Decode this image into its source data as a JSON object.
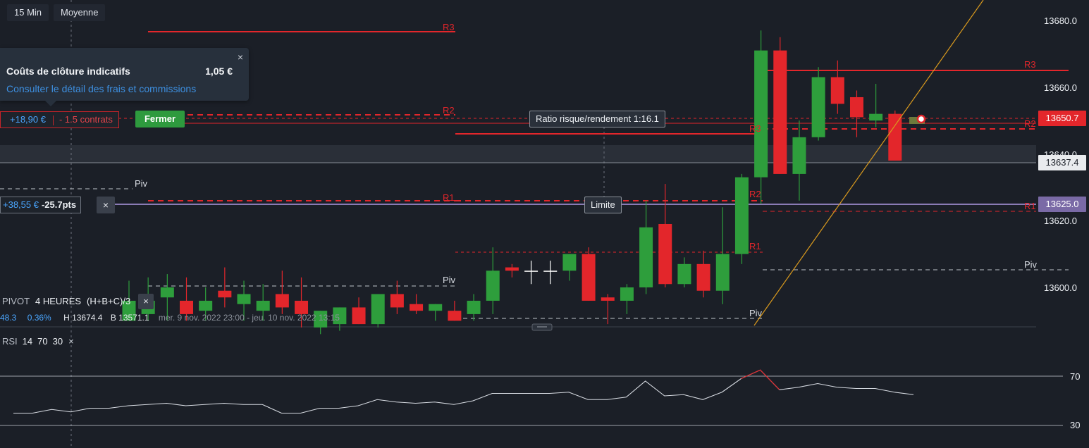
{
  "toolbar": {
    "timeframe": "15 Min",
    "chart_style": "Moyenne"
  },
  "popup": {
    "title": "Coûts de clôture indicatifs",
    "amount": "1,05 €",
    "link": "Consulter le détail des frais et commissions",
    "close": "×"
  },
  "position_main": {
    "pnl": "+18,90 €",
    "quantity": "- 1.5 contrats",
    "close_label": "Fermer"
  },
  "ratio_label": "Ratio risque/rendement 1:16.1",
  "position_limit": {
    "pnl": "+38,55 €",
    "points": "-25.7pts",
    "close": "×"
  },
  "limit_label": "Limite",
  "pivot_indicator": {
    "name": "PIVOT",
    "period": "4 HEURES",
    "formula": "(H+B+C)/3",
    "close": "×",
    "value_a": "48.3",
    "change": "0.36%",
    "high": "H 13674.4",
    "low": "B 13571.1",
    "range": "mer. 9 nov. 2022 23:00 - jeu. 10 nov. 2022 13:15"
  },
  "rsi_indicator": {
    "name": "RSI",
    "p1": "14",
    "p2": "70",
    "p3": "30",
    "close": "×"
  },
  "price_axis": [
    "13680.0",
    "13660.0",
    "13640.0",
    "13620.0",
    "13600.0"
  ],
  "price_tags": {
    "current": "13650.7",
    "line": "13637.4",
    "limit": "13625.0"
  },
  "rsi_axis": [
    "70",
    "30"
  ],
  "pivot_labels": {
    "r3": "R3",
    "r2": "R2",
    "r1": "R1",
    "piv": "Piv"
  },
  "colors": {
    "background": "#1b1f27",
    "bull": "#2e9e3c",
    "bear": "#e3262b",
    "pivot_resistance": "#e3262b",
    "trendline": "#d99a1e",
    "limit_line": "#8a7bb5",
    "link": "#3d8fe0"
  },
  "chart_data": {
    "type": "candlestick",
    "price_range": [
      13588,
      13684
    ],
    "y_ticks": [
      13680,
      13660,
      13640,
      13620,
      13600
    ],
    "candles": [
      {
        "o": 13590,
        "h": 13602,
        "l": 13590,
        "c": 13596
      },
      {
        "o": 13592,
        "h": 13603,
        "l": 13590,
        "c": 13596
      },
      {
        "o": 13597,
        "h": 13604,
        "l": 13590,
        "c": 13600
      },
      {
        "o": 13596,
        "h": 13603,
        "l": 13590,
        "c": 13592
      },
      {
        "o": 13593,
        "h": 13600,
        "l": 13590,
        "c": 13596
      },
      {
        "o": 13599,
        "h": 13606,
        "l": 13594,
        "c": 13597
      },
      {
        "o": 13595,
        "h": 13602,
        "l": 13590,
        "c": 13598
      },
      {
        "o": 13593,
        "h": 13601,
        "l": 13590,
        "c": 13596
      },
      {
        "o": 13598,
        "h": 13605,
        "l": 13592,
        "c": 13594
      },
      {
        "o": 13596,
        "h": 13603,
        "l": 13588,
        "c": 13592
      },
      {
        "o": 13588,
        "h": 13593,
        "l": 13586,
        "c": 13593
      },
      {
        "o": 13589,
        "h": 13594,
        "l": 13587,
        "c": 13594
      },
      {
        "o": 13594,
        "h": 13597,
        "l": 13589,
        "c": 13589
      },
      {
        "o": 13589,
        "h": 13598,
        "l": 13588,
        "c": 13598
      },
      {
        "o": 13598,
        "h": 13602,
        "l": 13592,
        "c": 13594
      },
      {
        "o": 13595,
        "h": 13598,
        "l": 13592,
        "c": 13593
      },
      {
        "o": 13593,
        "h": 13595,
        "l": 13590,
        "c": 13595
      },
      {
        "o": 13593,
        "h": 13596,
        "l": 13590,
        "c": 13590
      },
      {
        "o": 13592,
        "h": 13598,
        "l": 13590,
        "c": 13596
      },
      {
        "o": 13596,
        "h": 13612,
        "l": 13592,
        "c": 13605
      },
      {
        "o": 13606,
        "h": 13607,
        "l": 13603,
        "c": 13605
      },
      {
        "o": 13605,
        "h": 13608,
        "l": 13601,
        "c": 13605
      },
      {
        "o": 13605,
        "h": 13608,
        "l": 13601,
        "c": 13605
      },
      {
        "o": 13605,
        "h": 13610,
        "l": 13602,
        "c": 13610
      },
      {
        "o": 13610,
        "h": 13612,
        "l": 13596,
        "c": 13596
      },
      {
        "o": 13597,
        "h": 13598,
        "l": 13589,
        "c": 13596
      },
      {
        "o": 13596,
        "h": 13601,
        "l": 13592,
        "c": 13600
      },
      {
        "o": 13600,
        "h": 13626,
        "l": 13598,
        "c": 13618
      },
      {
        "o": 13619,
        "h": 13631,
        "l": 13600,
        "c": 13601
      },
      {
        "o": 13601,
        "h": 13609,
        "l": 13600,
        "c": 13607
      },
      {
        "o": 13607,
        "h": 13611,
        "l": 13597,
        "c": 13599
      },
      {
        "o": 13599,
        "h": 13624,
        "l": 13595,
        "c": 13610
      },
      {
        "o": 13610,
        "h": 13634,
        "l": 13607,
        "c": 13633
      },
      {
        "o": 13633,
        "h": 13677,
        "l": 13625,
        "c": 13671
      },
      {
        "o": 13671,
        "h": 13675,
        "l": 13634,
        "c": 13634
      },
      {
        "o": 13634,
        "h": 13650,
        "l": 13626,
        "c": 13645
      },
      {
        "o": 13645,
        "h": 13666,
        "l": 13644,
        "c": 13663
      },
      {
        "o": 13663,
        "h": 13668,
        "l": 13652,
        "c": 13655
      },
      {
        "o": 13657,
        "h": 13659,
        "l": 13645,
        "c": 13651
      },
      {
        "o": 13650,
        "h": 13661,
        "l": 13648,
        "c": 13652
      },
      {
        "o": 13652,
        "h": 13653,
        "l": 13638,
        "c": 13638
      }
    ],
    "rsi": [
      40,
      40,
      43,
      41,
      44,
      44,
      46,
      47,
      48,
      46,
      47,
      48,
      47,
      47,
      40,
      40,
      44,
      44,
      46,
      51,
      49,
      48,
      49,
      47,
      50,
      56,
      56,
      56,
      56,
      57,
      51,
      51,
      53,
      66,
      54,
      55,
      51,
      57,
      68,
      75,
      59,
      61,
      64,
      61,
      60,
      60,
      57,
      55
    ]
  }
}
